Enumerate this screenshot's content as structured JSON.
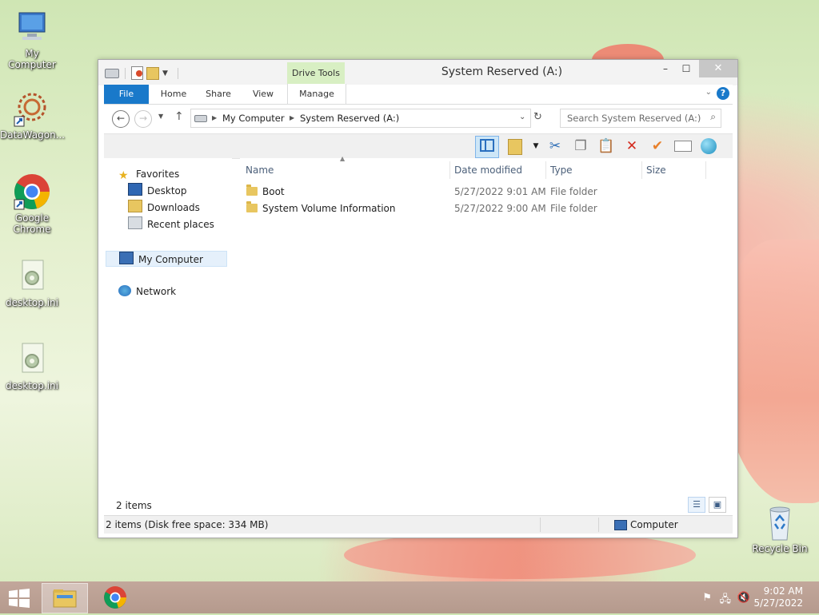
{
  "desktop": {
    "icons": [
      {
        "label": "My Computer"
      },
      {
        "label": "DataWagon..."
      },
      {
        "label": "Google\nChrome"
      },
      {
        "label": "desktop.ini"
      },
      {
        "label": "desktop.ini"
      },
      {
        "label": "Recycle Bin"
      }
    ]
  },
  "window": {
    "title": "System Reserved (A:)",
    "minimize": "–",
    "maximize": "☐",
    "close": "✕",
    "ribbon": {
      "tabs": [
        "File",
        "Home",
        "Share",
        "View"
      ],
      "contextual_group": "Drive Tools",
      "contextual_tab": "Manage"
    },
    "address": {
      "segments": [
        "My Computer",
        "System Reserved (A:)"
      ],
      "search_placeholder": "Search System Reserved (A:)"
    },
    "nav": {
      "favorites": "Favorites",
      "favorite_items": [
        "Desktop",
        "Downloads",
        "Recent places"
      ],
      "computer": "My Computer",
      "network": "Network"
    },
    "columns": [
      "Name",
      "Date modified",
      "Type",
      "Size"
    ],
    "rows": [
      {
        "name": "Boot",
        "date": "5/27/2022 9:01 AM",
        "type": "File folder",
        "size": ""
      },
      {
        "name": "System Volume Information",
        "date": "5/27/2022 9:00 AM",
        "type": "File folder",
        "size": ""
      }
    ],
    "item_count": "2 items",
    "status_left": "2 items (Disk free space: 334 MB)",
    "status_right": "Computer"
  },
  "taskbar": {
    "time": "9:02 AM",
    "date": "5/27/2022"
  },
  "colors": {
    "accent": "#1979ca",
    "drive_tools": "#d8efc3"
  }
}
